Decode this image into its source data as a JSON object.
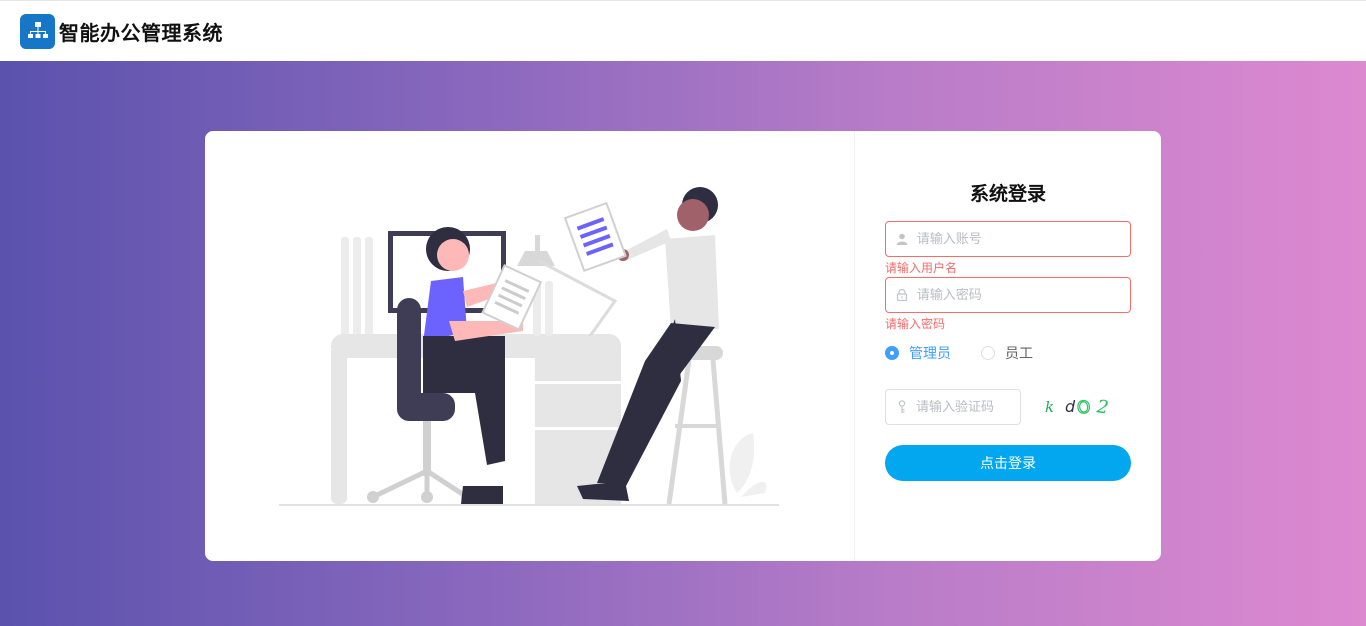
{
  "header": {
    "app_title": "智能办公管理系统",
    "logo_icon": "org-chart-icon"
  },
  "login": {
    "title": "系统登录",
    "username": {
      "placeholder": "请输入账号",
      "value": "",
      "error": "请输入用户名",
      "icon": "user-icon"
    },
    "password": {
      "placeholder": "请输入密码",
      "value": "",
      "error": "请输入密码",
      "icon": "lock-icon"
    },
    "roles": [
      {
        "label": "管理员",
        "checked": true
      },
      {
        "label": "员工",
        "checked": false
      }
    ],
    "captcha": {
      "placeholder": "请输入验证码",
      "value": "",
      "icon": "key-icon",
      "code": "kdO2"
    },
    "submit_label": "点击登录"
  },
  "colors": {
    "accent": "#02a7f0",
    "error": "#f56c6c",
    "radio_active": "#409eff",
    "gradient_start": "#5a52ad",
    "gradient_end": "#dd89d0"
  }
}
